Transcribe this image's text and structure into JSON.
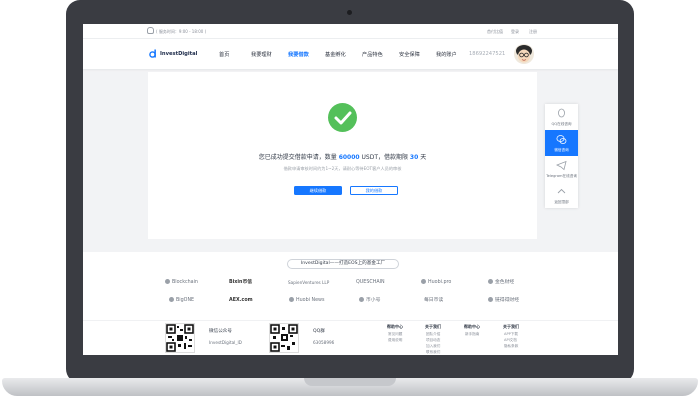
{
  "topbar": {
    "hotline": "( 服务时间：9:00 - 18:00 )",
    "links": [
      "首付比值",
      "登录",
      "注册"
    ]
  },
  "nav": {
    "logo": "InvestDigital",
    "items": [
      "首页",
      "我要理财",
      "我要借款",
      "基金孵化",
      "产品特色",
      "安全保障",
      "我的账户"
    ],
    "active_index": 2,
    "phone": "18692247521"
  },
  "result": {
    "message_prefix": "您已成功提交借款申请，数量",
    "amount": "60000",
    "unit_text": "USDT，借款期限",
    "term": "30",
    "term_unit": "天",
    "subtext": "借款申请审核时间约为1~2天，请耐心等待EOT客户人员的审核",
    "primary_button": "继续借款",
    "secondary_button": "我的借款"
  },
  "sidebar": {
    "items": [
      {
        "label": "QQ在线咨询",
        "icon": "qq-icon"
      },
      {
        "label": "微信咨询",
        "icon": "wechat-icon"
      },
      {
        "label": "Telegram在线咨询",
        "icon": "telegram-icon"
      },
      {
        "label": "返回顶部",
        "icon": "chevron-up-icon"
      }
    ],
    "active_index": 1
  },
  "partners": {
    "slogan": "InvestDigital——打造EOS上的基金工厂",
    "logos": [
      "Blockchain",
      "Bixin币信",
      "SapienVentures LLP",
      "QUESCHAIN",
      "Huobi.pro",
      "金色财经",
      "BigONE",
      "AEX.com",
      "Huobi News",
      "币小号",
      "每日币读",
      "链得得财经"
    ]
  },
  "footer": {
    "wechat_title": "微信公众号",
    "wechat_id": "InvestDigital_ID",
    "qq_title": "QQ群",
    "qq_id": "63058996",
    "columns": [
      {
        "head": "帮助中心",
        "links": [
          "常见问题",
          "费用说明"
        ]
      },
      {
        "head": "关于我们",
        "links": [
          "团队介绍",
          "项目动态",
          "加入我们",
          "联系我们"
        ]
      },
      {
        "head": "帮助中心",
        "links": [
          "新手指南"
        ]
      },
      {
        "head": "关于我们",
        "links": [
          "APP下载",
          "API文档",
          "隐私条款"
        ]
      }
    ]
  }
}
